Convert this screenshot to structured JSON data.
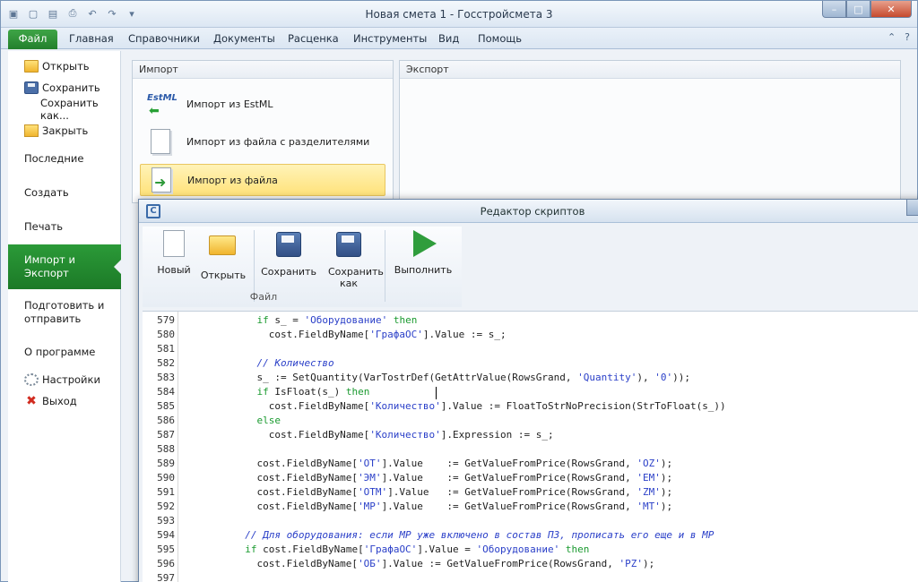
{
  "window": {
    "title": "Новая смета 1 - Госстройсмета 3"
  },
  "tabs": [
    "Файл",
    "Главная",
    "Справочники",
    "Документы",
    "Расценка",
    "Инструменты",
    "Вид",
    "Помощь"
  ],
  "sidebar": {
    "items": [
      {
        "label": "Открыть",
        "icon": "folder-icon"
      },
      {
        "label": "Сохранить",
        "icon": "save-icon"
      },
      {
        "label": "Сохранить как...",
        "icon": ""
      },
      {
        "label": "Закрыть",
        "icon": "close-folder-icon"
      },
      {
        "label": "Последние",
        "icon": ""
      },
      {
        "label": "Создать",
        "icon": ""
      },
      {
        "label": "Печать",
        "icon": ""
      },
      {
        "label": "Импорт и Экспорт",
        "icon": ""
      },
      {
        "label": "Подготовить и отправить",
        "icon": ""
      },
      {
        "label": "О программе",
        "icon": ""
      },
      {
        "label": "Настройки",
        "icon": "gear-icon"
      },
      {
        "label": "Выход",
        "icon": "exit-icon"
      }
    ]
  },
  "import_panel": {
    "title": "Импорт",
    "items": [
      {
        "label": "Импорт из EstML",
        "icon": "estml-icon",
        "logo_text": "EstML"
      },
      {
        "label": "Импорт из файла с разделителями",
        "icon": "delimited-file-icon"
      },
      {
        "label": "Импорт из файла",
        "icon": "import-file-icon"
      }
    ]
  },
  "export_panel": {
    "title": "Экспорт"
  },
  "editor": {
    "title": "Редактор скриптов",
    "toolbar": {
      "new": "Новый",
      "open": "Открыть",
      "save": "Сохранить",
      "save_as": "Сохранить как",
      "run": "Выполнить",
      "group": "Файл"
    },
    "lines": [
      {
        "n": "579",
        "segs": [
          [
            "tx",
            "            "
          ],
          [
            "kw",
            "if"
          ],
          [
            "tx",
            " s_ = "
          ],
          [
            "str",
            "'Оборудование'"
          ],
          [
            "tx",
            " "
          ],
          [
            "kw",
            "then"
          ]
        ]
      },
      {
        "n": "580",
        "segs": [
          [
            "tx",
            "              cost.FieldByName["
          ],
          [
            "str",
            "'ГрафаОС'"
          ],
          [
            "tx",
            "].Value := s_;"
          ]
        ]
      },
      {
        "n": "581",
        "segs": []
      },
      {
        "n": "582",
        "segs": [
          [
            "cm",
            "            // Количество"
          ]
        ]
      },
      {
        "n": "583",
        "segs": [
          [
            "tx",
            "            s_ := SetQuantity(VarTostrDef(GetAttrValue(RowsGrand, "
          ],
          [
            "str",
            "'Quantity'"
          ],
          [
            "tx",
            "), "
          ],
          [
            "str",
            "'0'"
          ],
          [
            "tx",
            "));"
          ]
        ]
      },
      {
        "n": "584",
        "segs": [
          [
            "tx",
            "            "
          ],
          [
            "kw",
            "if"
          ],
          [
            "tx",
            " IsFloat(s_) "
          ],
          [
            "kw",
            "then"
          ]
        ]
      },
      {
        "n": "585",
        "segs": [
          [
            "tx",
            "              cost.FieldByName["
          ],
          [
            "str",
            "'Количество'"
          ],
          [
            "tx",
            "].Value := FloatToStrNoPrecision(StrToFloat(s_))"
          ]
        ]
      },
      {
        "n": "586",
        "segs": [
          [
            "tx",
            "            "
          ],
          [
            "kw",
            "else"
          ]
        ]
      },
      {
        "n": "587",
        "segs": [
          [
            "tx",
            "              cost.FieldByName["
          ],
          [
            "str",
            "'Количество'"
          ],
          [
            "tx",
            "].Expression := s_;"
          ]
        ]
      },
      {
        "n": "588",
        "segs": []
      },
      {
        "n": "589",
        "segs": [
          [
            "tx",
            "            cost.FieldByName["
          ],
          [
            "str",
            "'ОТ'"
          ],
          [
            "tx",
            "].Value    := GetValueFromPrice(RowsGrand, "
          ],
          [
            "str",
            "'OZ'"
          ],
          [
            "tx",
            ");"
          ]
        ]
      },
      {
        "n": "590",
        "segs": [
          [
            "tx",
            "            cost.FieldByName["
          ],
          [
            "str",
            "'ЭМ'"
          ],
          [
            "tx",
            "].Value    := GetValueFromPrice(RowsGrand, "
          ],
          [
            "str",
            "'EM'"
          ],
          [
            "tx",
            ");"
          ]
        ]
      },
      {
        "n": "591",
        "segs": [
          [
            "tx",
            "            cost.FieldByName["
          ],
          [
            "str",
            "'ОТМ'"
          ],
          [
            "tx",
            "].Value   := GetValueFromPrice(RowsGrand, "
          ],
          [
            "str",
            "'ZM'"
          ],
          [
            "tx",
            ");"
          ]
        ]
      },
      {
        "n": "592",
        "segs": [
          [
            "tx",
            "            cost.FieldByName["
          ],
          [
            "str",
            "'МР'"
          ],
          [
            "tx",
            "].Value    := GetValueFromPrice(RowsGrand, "
          ],
          [
            "str",
            "'MT'"
          ],
          [
            "tx",
            ");"
          ]
        ]
      },
      {
        "n": "593",
        "segs": []
      },
      {
        "n": "594",
        "segs": [
          [
            "cm",
            "          // Для оборудования: если МР уже включено в состав ПЗ, прописать его еще и в МР"
          ]
        ]
      },
      {
        "n": "595",
        "segs": [
          [
            "tx",
            "          "
          ],
          [
            "kw",
            "if"
          ],
          [
            "tx",
            " cost.FieldByName["
          ],
          [
            "str",
            "'ГрафаОС'"
          ],
          [
            "tx",
            "].Value = "
          ],
          [
            "str",
            "'Оборудование'"
          ],
          [
            "tx",
            " "
          ],
          [
            "kw",
            "then"
          ]
        ]
      },
      {
        "n": "596",
        "segs": [
          [
            "tx",
            "            cost.FieldByName["
          ],
          [
            "str",
            "'ОБ'"
          ],
          [
            "tx",
            "].Value := GetValueFromPrice(RowsGrand, "
          ],
          [
            "str",
            "'PZ'"
          ],
          [
            "tx",
            ");"
          ]
        ]
      },
      {
        "n": "597",
        "segs": []
      }
    ]
  }
}
